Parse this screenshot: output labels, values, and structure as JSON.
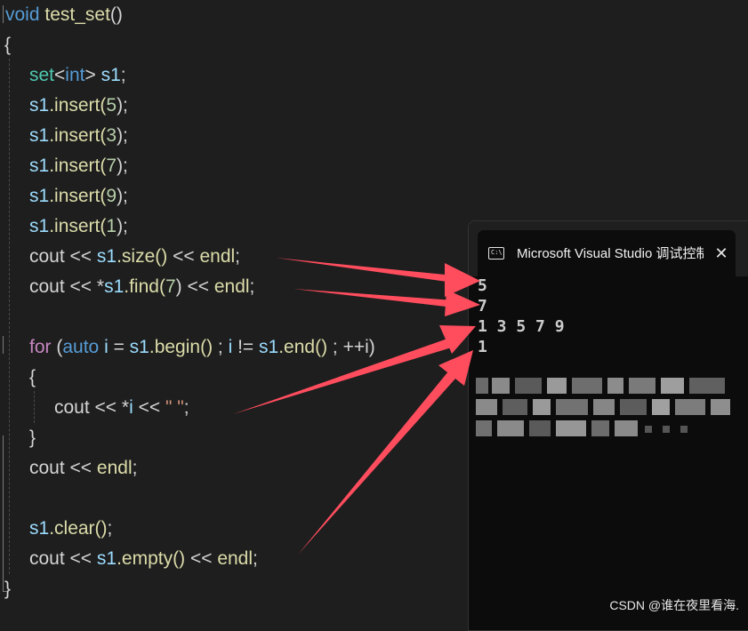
{
  "code": {
    "signature": {
      "kw": "void",
      "name": "test_set",
      "params": "()"
    },
    "open_brace": "{",
    "close_brace": "}",
    "decl": {
      "type": "set",
      "lt": "<",
      "tparam": "int",
      "gt": ">",
      "name": "s1",
      "end": ";"
    },
    "inserts": [
      {
        "obj": "s1",
        "call": ".insert(",
        "arg": "5",
        "end": ");"
      },
      {
        "obj": "s1",
        "call": ".insert(",
        "arg": "3",
        "end": ");"
      },
      {
        "obj": "s1",
        "call": ".insert(",
        "arg": "7",
        "end": ");"
      },
      {
        "obj": "s1",
        "call": ".insert(",
        "arg": "9",
        "end": ");"
      },
      {
        "obj": "s1",
        "call": ".insert(",
        "arg": "1",
        "end": ");"
      }
    ],
    "size_line": {
      "cout": "cout",
      "op1": " << ",
      "obj": "s1",
      "call": ".size()",
      "op2": " << ",
      "endl": "endl",
      "end": ";"
    },
    "find_line": {
      "cout": "cout",
      "op1": " << *",
      "obj": "s1",
      "call": ".find(",
      "arg": "7",
      "close": ")",
      "op2": " << ",
      "endl": "endl",
      "end": ";"
    },
    "for_line": {
      "kw": "for",
      "p1": " (",
      "auto": "auto",
      "i": "i",
      "eq": " = ",
      "obj1": "s1",
      "begin": ".begin()",
      "semi1": " ; ",
      "i2": "i",
      "ne": " != ",
      "obj2": "s1",
      "end_call": ".end()",
      "semi2": " ; ",
      "inc": "++i)"
    },
    "loop_open": "{",
    "loop_body": {
      "cout": "cout",
      "op1": " << *",
      "i": "i",
      "op2": " << ",
      "str": "\" \"",
      "end": ";"
    },
    "loop_close": "}",
    "endl_line": {
      "cout": "cout",
      "op": " << ",
      "endl": "endl",
      "end": ";"
    },
    "clear_line": {
      "obj": "s1",
      "call": ".clear()",
      "end": ";"
    },
    "empty_line": {
      "cout": "cout",
      "op1": " << ",
      "obj": "s1",
      "call": ".empty()",
      "op2": " << ",
      "endl": "endl",
      "end": ";"
    }
  },
  "console": {
    "title": "Microsoft Visual Studio 调试控制台",
    "icon_text": "C:\\",
    "close_glyph": "✕",
    "output": [
      "5",
      "7",
      "1 3 5 7 9",
      "1"
    ]
  },
  "annotation_color": "#ff4d5e",
  "watermark": "CSDN @谁在夜里看海."
}
